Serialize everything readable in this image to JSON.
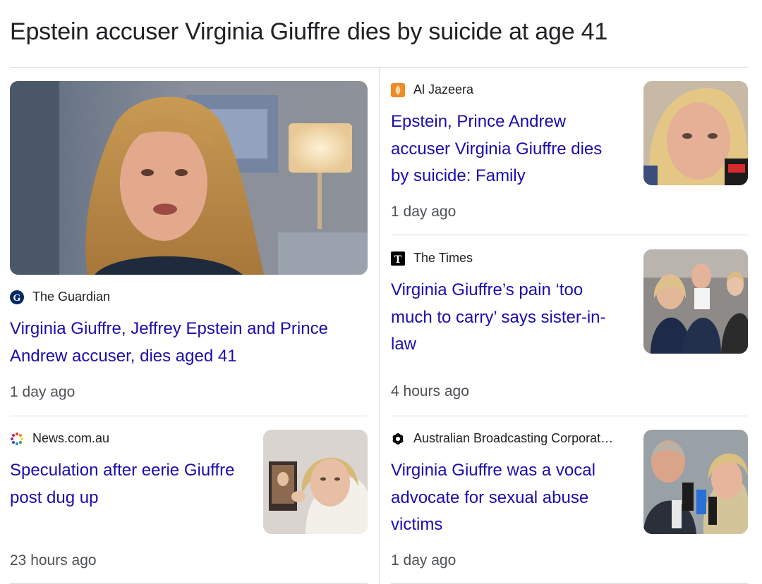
{
  "heading": "Epstein accuser Virginia Giuffre dies by suicide at age 41",
  "cards": [
    {
      "source": "The Guardian",
      "source_icon": "guardian-logo-icon",
      "title": "Virginia Giuffre, Jeffrey Epstein and Prince Andrew accuser, dies aged 41",
      "time": "1 day ago"
    },
    {
      "source": "Al Jazeera",
      "source_icon": "al-jazeera-logo-icon",
      "title": "Epstein, Prince Andrew accuser Virginia Giuffre dies by suicide: Family",
      "time": "1 day ago"
    },
    {
      "source": "The Times",
      "source_icon": "the-times-logo-icon",
      "title": "Virginia Giuffre’s pain ‘too much to carry’ says sister-in-law",
      "time": "4 hours ago"
    },
    {
      "source": "News.com.au",
      "source_icon": "news-com-au-logo-icon",
      "title": "Speculation after eerie Giuffre post dug up",
      "time": "23 hours ago"
    },
    {
      "source": "Australian Broadcasting Corporat…",
      "source_icon": "abc-logo-icon",
      "title": "Virginia Giuffre was a vocal advocate for sexual abuse victims",
      "time": "1 day ago"
    }
  ],
  "colors": {
    "link": "#1a0dab",
    "text": "#202124",
    "meta": "#4d5156",
    "divider": "#dadce0"
  }
}
